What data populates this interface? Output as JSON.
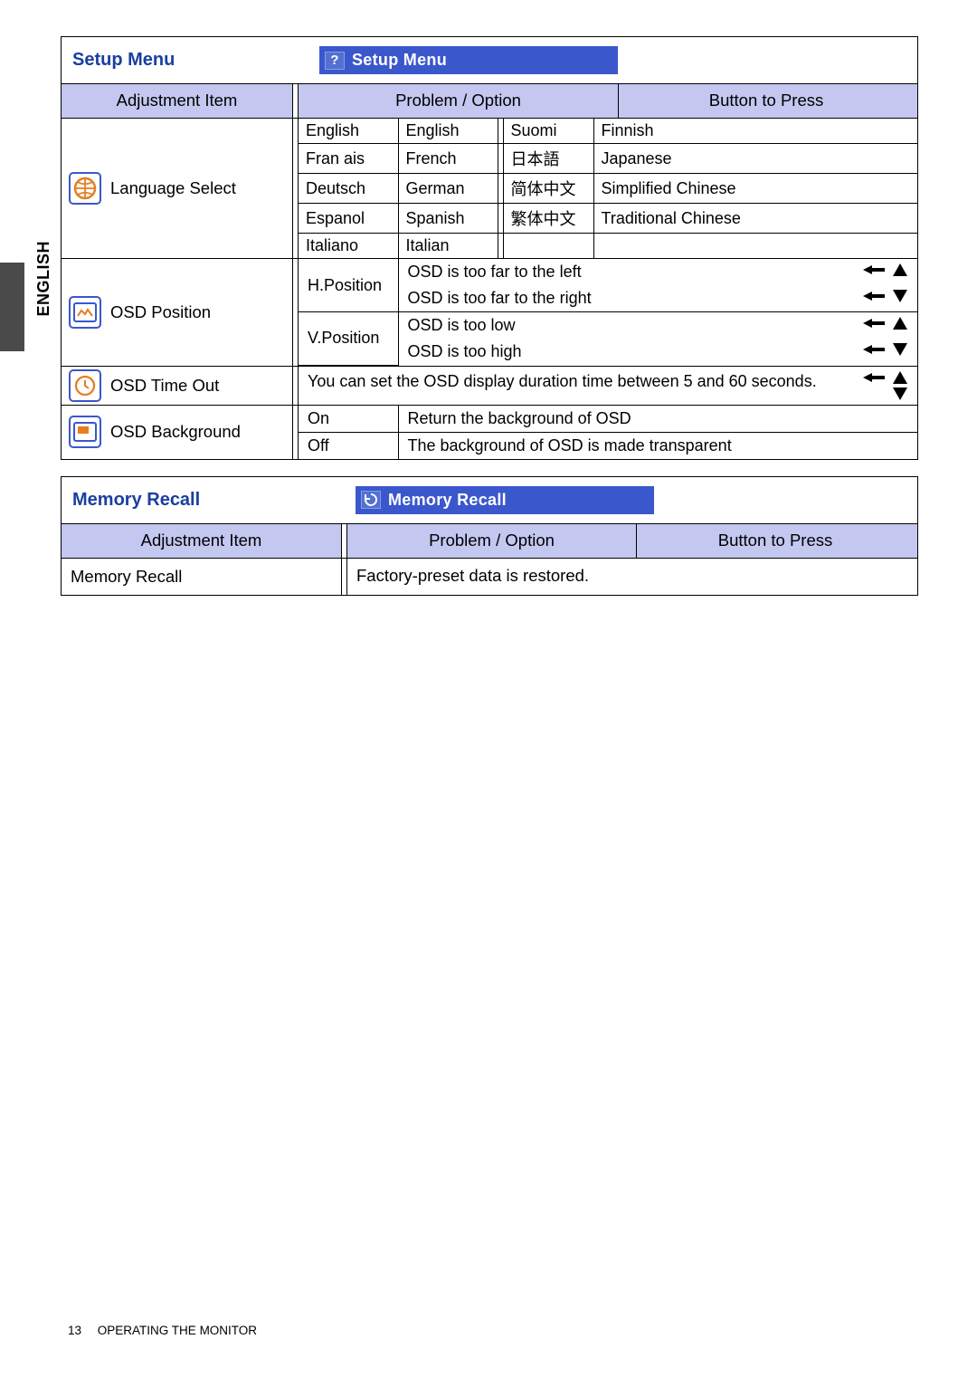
{
  "side": {
    "label": "ENGLISH"
  },
  "setup": {
    "title": "Setup Menu",
    "badge": "Setup Menu",
    "headers": {
      "item": "Adjustment Item",
      "problem": "Problem / Option",
      "button": "Button to Press"
    },
    "rows": {
      "language": {
        "label": "Language Select",
        "options": [
          {
            "native": "English",
            "en": "English",
            "native2": "Suomi",
            "en2": "Finnish"
          },
          {
            "native": "Fran ais",
            "en": "French",
            "native2": "日本語",
            "en2": "Japanese"
          },
          {
            "native": "Deutsch",
            "en": "German",
            "native2": "简体中文",
            "en2": "Simplified Chinese"
          },
          {
            "native": "Espanol",
            "en": "Spanish",
            "native2": "繁体中文",
            "en2": "Traditional Chinese"
          },
          {
            "native": "Italiano",
            "en": "Italian",
            "native2": "",
            "en2": ""
          }
        ]
      },
      "osdpos": {
        "label": "OSD Position",
        "h": {
          "label": "H.Position",
          "a": "OSD is too far to the left",
          "b": "OSD is too far to the right"
        },
        "v": {
          "label": "V.Position",
          "a": "OSD is too low",
          "b": "OSD is too high"
        }
      },
      "timeout": {
        "label": "OSD Time Out",
        "desc": "You can set the OSD display duration time between 5 and 60 seconds."
      },
      "bg": {
        "label": "OSD Background",
        "on": {
          "k": "On",
          "v": "Return the background of OSD"
        },
        "off": {
          "k": "Off",
          "v": "The background of OSD is made transparent"
        }
      }
    }
  },
  "recall": {
    "title": "Memory Recall",
    "badge": "Memory Recall",
    "headers": {
      "item": "Adjustment Item",
      "problem": "Problem / Option",
      "button": "Button to Press"
    },
    "row": {
      "label": "Memory Recall",
      "desc": "Factory-preset data is restored."
    }
  },
  "footer": {
    "page": "13",
    "section": "OPERATING THE MONITOR"
  }
}
